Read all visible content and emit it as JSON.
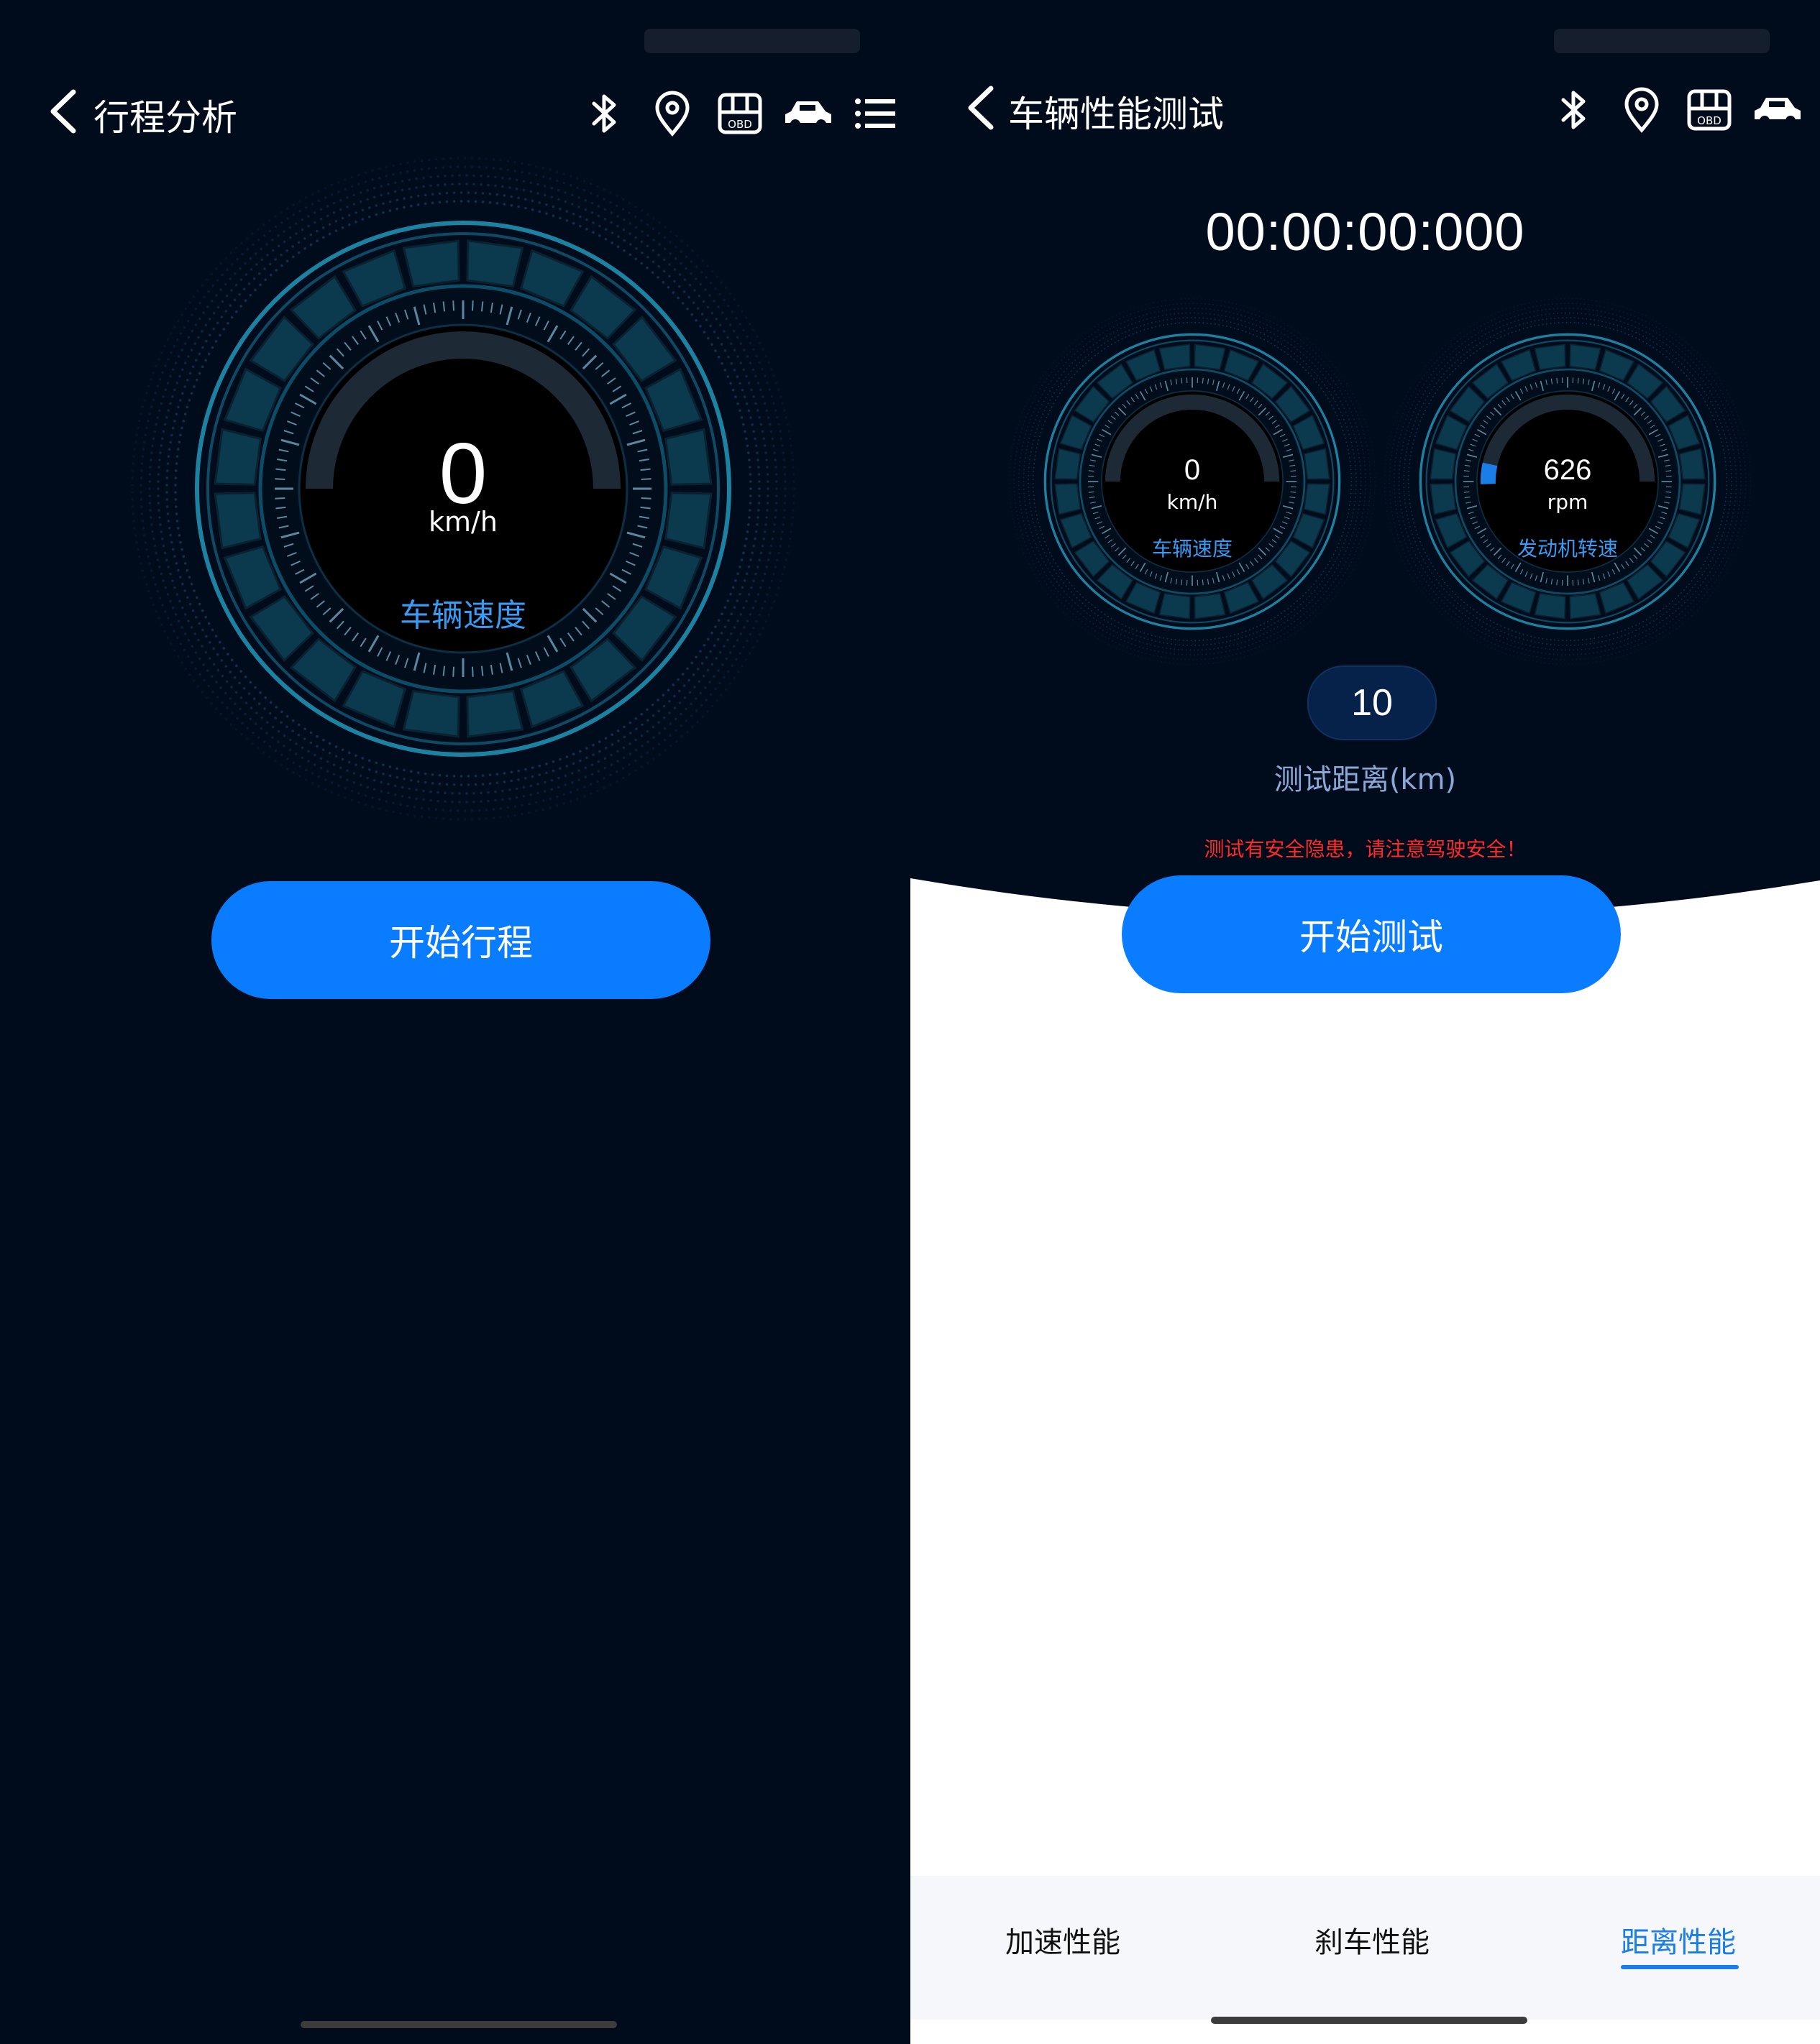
{
  "left": {
    "title": "行程分析",
    "icons": [
      "bluetooth-icon",
      "location-pin-icon",
      "obd-icon",
      "car-icon",
      "list-icon"
    ],
    "obd_text": "OBD",
    "gauge": {
      "value": "0",
      "unit": "km/h",
      "label": "车辆速度"
    },
    "start_button": "开始行程"
  },
  "right": {
    "title": "车辆性能测试",
    "icons": [
      "bluetooth-icon",
      "location-pin-icon",
      "obd-icon",
      "car-icon"
    ],
    "obd_text": "OBD",
    "timer": "00:00:00:000",
    "speed_gauge": {
      "value": "0",
      "unit": "km/h",
      "label": "车辆速度"
    },
    "rpm_gauge": {
      "value": "626",
      "unit": "rpm",
      "label": "发动机转速"
    },
    "distance": {
      "value": "10",
      "label": "测试距离(km)"
    },
    "warning": "测试有安全隐患，请注意驾驶安全！",
    "start_button": "开始测试",
    "tabs": [
      {
        "label": "加速性能",
        "active": false
      },
      {
        "label": "刹车性能",
        "active": false
      },
      {
        "label": "距离性能",
        "active": true
      }
    ]
  },
  "colors": {
    "background_dark": "#000b1b",
    "accent_blue": "#0a7cff",
    "gauge_cyan": "#1f8fb0",
    "label_blue": "#3a9bf5",
    "warning_red": "#ff2a2a",
    "tab_active": "#1a7de8"
  }
}
